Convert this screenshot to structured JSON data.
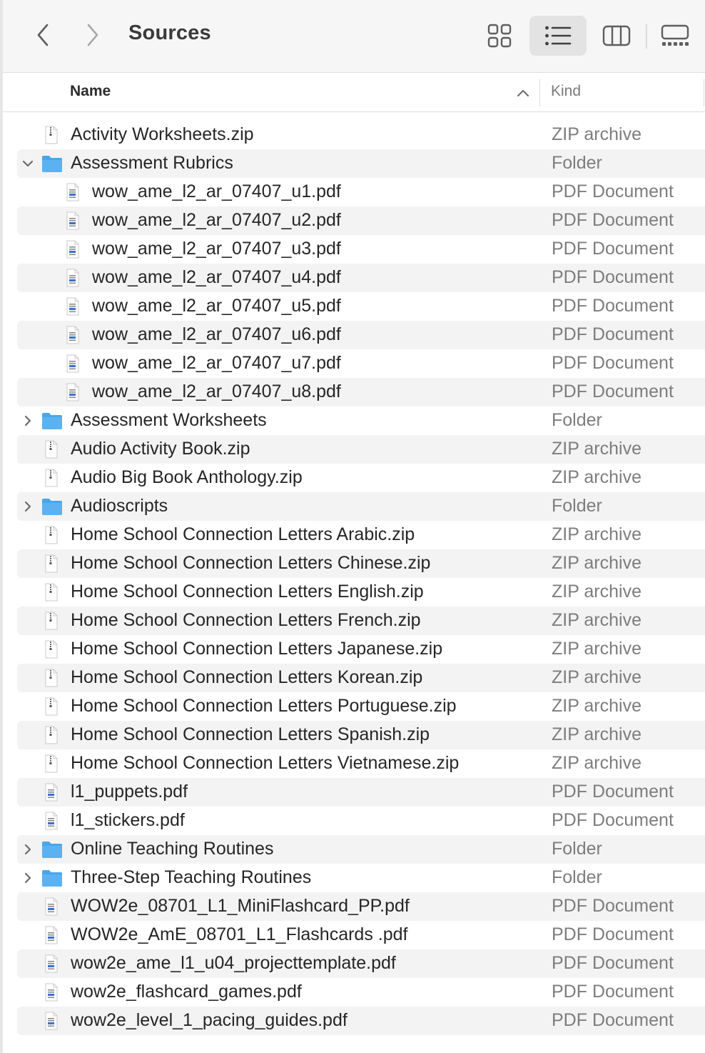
{
  "window": {
    "title": "Sources",
    "view_modes": [
      "icons-view",
      "list-view",
      "columns-view",
      "gallery-view"
    ],
    "active_view": "list-view"
  },
  "columns": {
    "name": "Name",
    "kind": "Kind",
    "sort": "ascending"
  },
  "colors": {
    "folder": "#5ab2f2",
    "selected_view_bg": "#e3e3e3",
    "stripe": "#f3f3f3",
    "kind_text": "#7d7d7d"
  },
  "rows": [
    {
      "name": "Activity Worksheets.zip",
      "kind": "ZIP archive",
      "icon": "zip",
      "depth": 0,
      "disclosure": "none"
    },
    {
      "name": "Assessment Rubrics",
      "kind": "Folder",
      "icon": "folder",
      "depth": 0,
      "disclosure": "expanded"
    },
    {
      "name": "wow_ame_l2_ar_07407_u1.pdf",
      "kind": "PDF Document",
      "icon": "pdf",
      "depth": 1,
      "disclosure": "none"
    },
    {
      "name": "wow_ame_l2_ar_07407_u2.pdf",
      "kind": "PDF Document",
      "icon": "pdf",
      "depth": 1,
      "disclosure": "none"
    },
    {
      "name": "wow_ame_l2_ar_07407_u3.pdf",
      "kind": "PDF Document",
      "icon": "pdf",
      "depth": 1,
      "disclosure": "none"
    },
    {
      "name": "wow_ame_l2_ar_07407_u4.pdf",
      "kind": "PDF Document",
      "icon": "pdf",
      "depth": 1,
      "disclosure": "none"
    },
    {
      "name": "wow_ame_l2_ar_07407_u5.pdf",
      "kind": "PDF Document",
      "icon": "pdf",
      "depth": 1,
      "disclosure": "none"
    },
    {
      "name": "wow_ame_l2_ar_07407_u6.pdf",
      "kind": "PDF Document",
      "icon": "pdf",
      "depth": 1,
      "disclosure": "none"
    },
    {
      "name": "wow_ame_l2_ar_07407_u7.pdf",
      "kind": "PDF Document",
      "icon": "pdf",
      "depth": 1,
      "disclosure": "none"
    },
    {
      "name": "wow_ame_l2_ar_07407_u8.pdf",
      "kind": "PDF Document",
      "icon": "pdf",
      "depth": 1,
      "disclosure": "none"
    },
    {
      "name": "Assessment Worksheets",
      "kind": "Folder",
      "icon": "folder",
      "depth": 0,
      "disclosure": "collapsed"
    },
    {
      "name": "Audio Activity Book.zip",
      "kind": "ZIP archive",
      "icon": "zip",
      "depth": 0,
      "disclosure": "none"
    },
    {
      "name": "Audio Big Book Anthology.zip",
      "kind": "ZIP archive",
      "icon": "zip",
      "depth": 0,
      "disclosure": "none"
    },
    {
      "name": "Audioscripts",
      "kind": "Folder",
      "icon": "folder",
      "depth": 0,
      "disclosure": "collapsed"
    },
    {
      "name": "Home School Connection Letters Arabic.zip",
      "kind": "ZIP archive",
      "icon": "zip",
      "depth": 0,
      "disclosure": "none"
    },
    {
      "name": "Home School Connection Letters Chinese.zip",
      "kind": "ZIP archive",
      "icon": "zip",
      "depth": 0,
      "disclosure": "none"
    },
    {
      "name": "Home School Connection Letters English.zip",
      "kind": "ZIP archive",
      "icon": "zip",
      "depth": 0,
      "disclosure": "none"
    },
    {
      "name": "Home School Connection Letters French.zip",
      "kind": "ZIP archive",
      "icon": "zip",
      "depth": 0,
      "disclosure": "none"
    },
    {
      "name": "Home School Connection Letters Japanese.zip",
      "kind": "ZIP archive",
      "icon": "zip",
      "depth": 0,
      "disclosure": "none"
    },
    {
      "name": "Home School Connection Letters Korean.zip",
      "kind": "ZIP archive",
      "icon": "zip",
      "depth": 0,
      "disclosure": "none"
    },
    {
      "name": "Home School Connection Letters Portuguese.zip",
      "kind": "ZIP archive",
      "icon": "zip",
      "depth": 0,
      "disclosure": "none"
    },
    {
      "name": "Home School Connection Letters Spanish.zip",
      "kind": "ZIP archive",
      "icon": "zip",
      "depth": 0,
      "disclosure": "none"
    },
    {
      "name": "Home School Connection Letters Vietnamese.zip",
      "kind": "ZIP archive",
      "icon": "zip",
      "depth": 0,
      "disclosure": "none"
    },
    {
      "name": "l1_puppets.pdf",
      "kind": "PDF Document",
      "icon": "pdf",
      "depth": 0,
      "disclosure": "none"
    },
    {
      "name": "l1_stickers.pdf",
      "kind": "PDF Document",
      "icon": "pdf",
      "depth": 0,
      "disclosure": "none"
    },
    {
      "name": "Online Teaching Routines",
      "kind": "Folder",
      "icon": "folder",
      "depth": 0,
      "disclosure": "collapsed"
    },
    {
      "name": "Three-Step Teaching Routines",
      "kind": "Folder",
      "icon": "folder",
      "depth": 0,
      "disclosure": "collapsed"
    },
    {
      "name": "WOW2e_08701_L1_MiniFlashcard_PP.pdf",
      "kind": "PDF Document",
      "icon": "pdf",
      "depth": 0,
      "disclosure": "none"
    },
    {
      "name": "WOW2e_AmE_08701_L1_Flashcards .pdf",
      "kind": "PDF Document",
      "icon": "pdf",
      "depth": 0,
      "disclosure": "none"
    },
    {
      "name": "wow2e_ame_l1_u04_projecttemplate.pdf",
      "kind": "PDF Document",
      "icon": "pdf",
      "depth": 0,
      "disclosure": "none"
    },
    {
      "name": "wow2e_flashcard_games.pdf",
      "kind": "PDF Document",
      "icon": "pdf",
      "depth": 0,
      "disclosure": "none"
    },
    {
      "name": "wow2e_level_1_pacing_guides.pdf",
      "kind": "PDF Document",
      "icon": "pdf",
      "depth": 0,
      "disclosure": "none"
    }
  ]
}
